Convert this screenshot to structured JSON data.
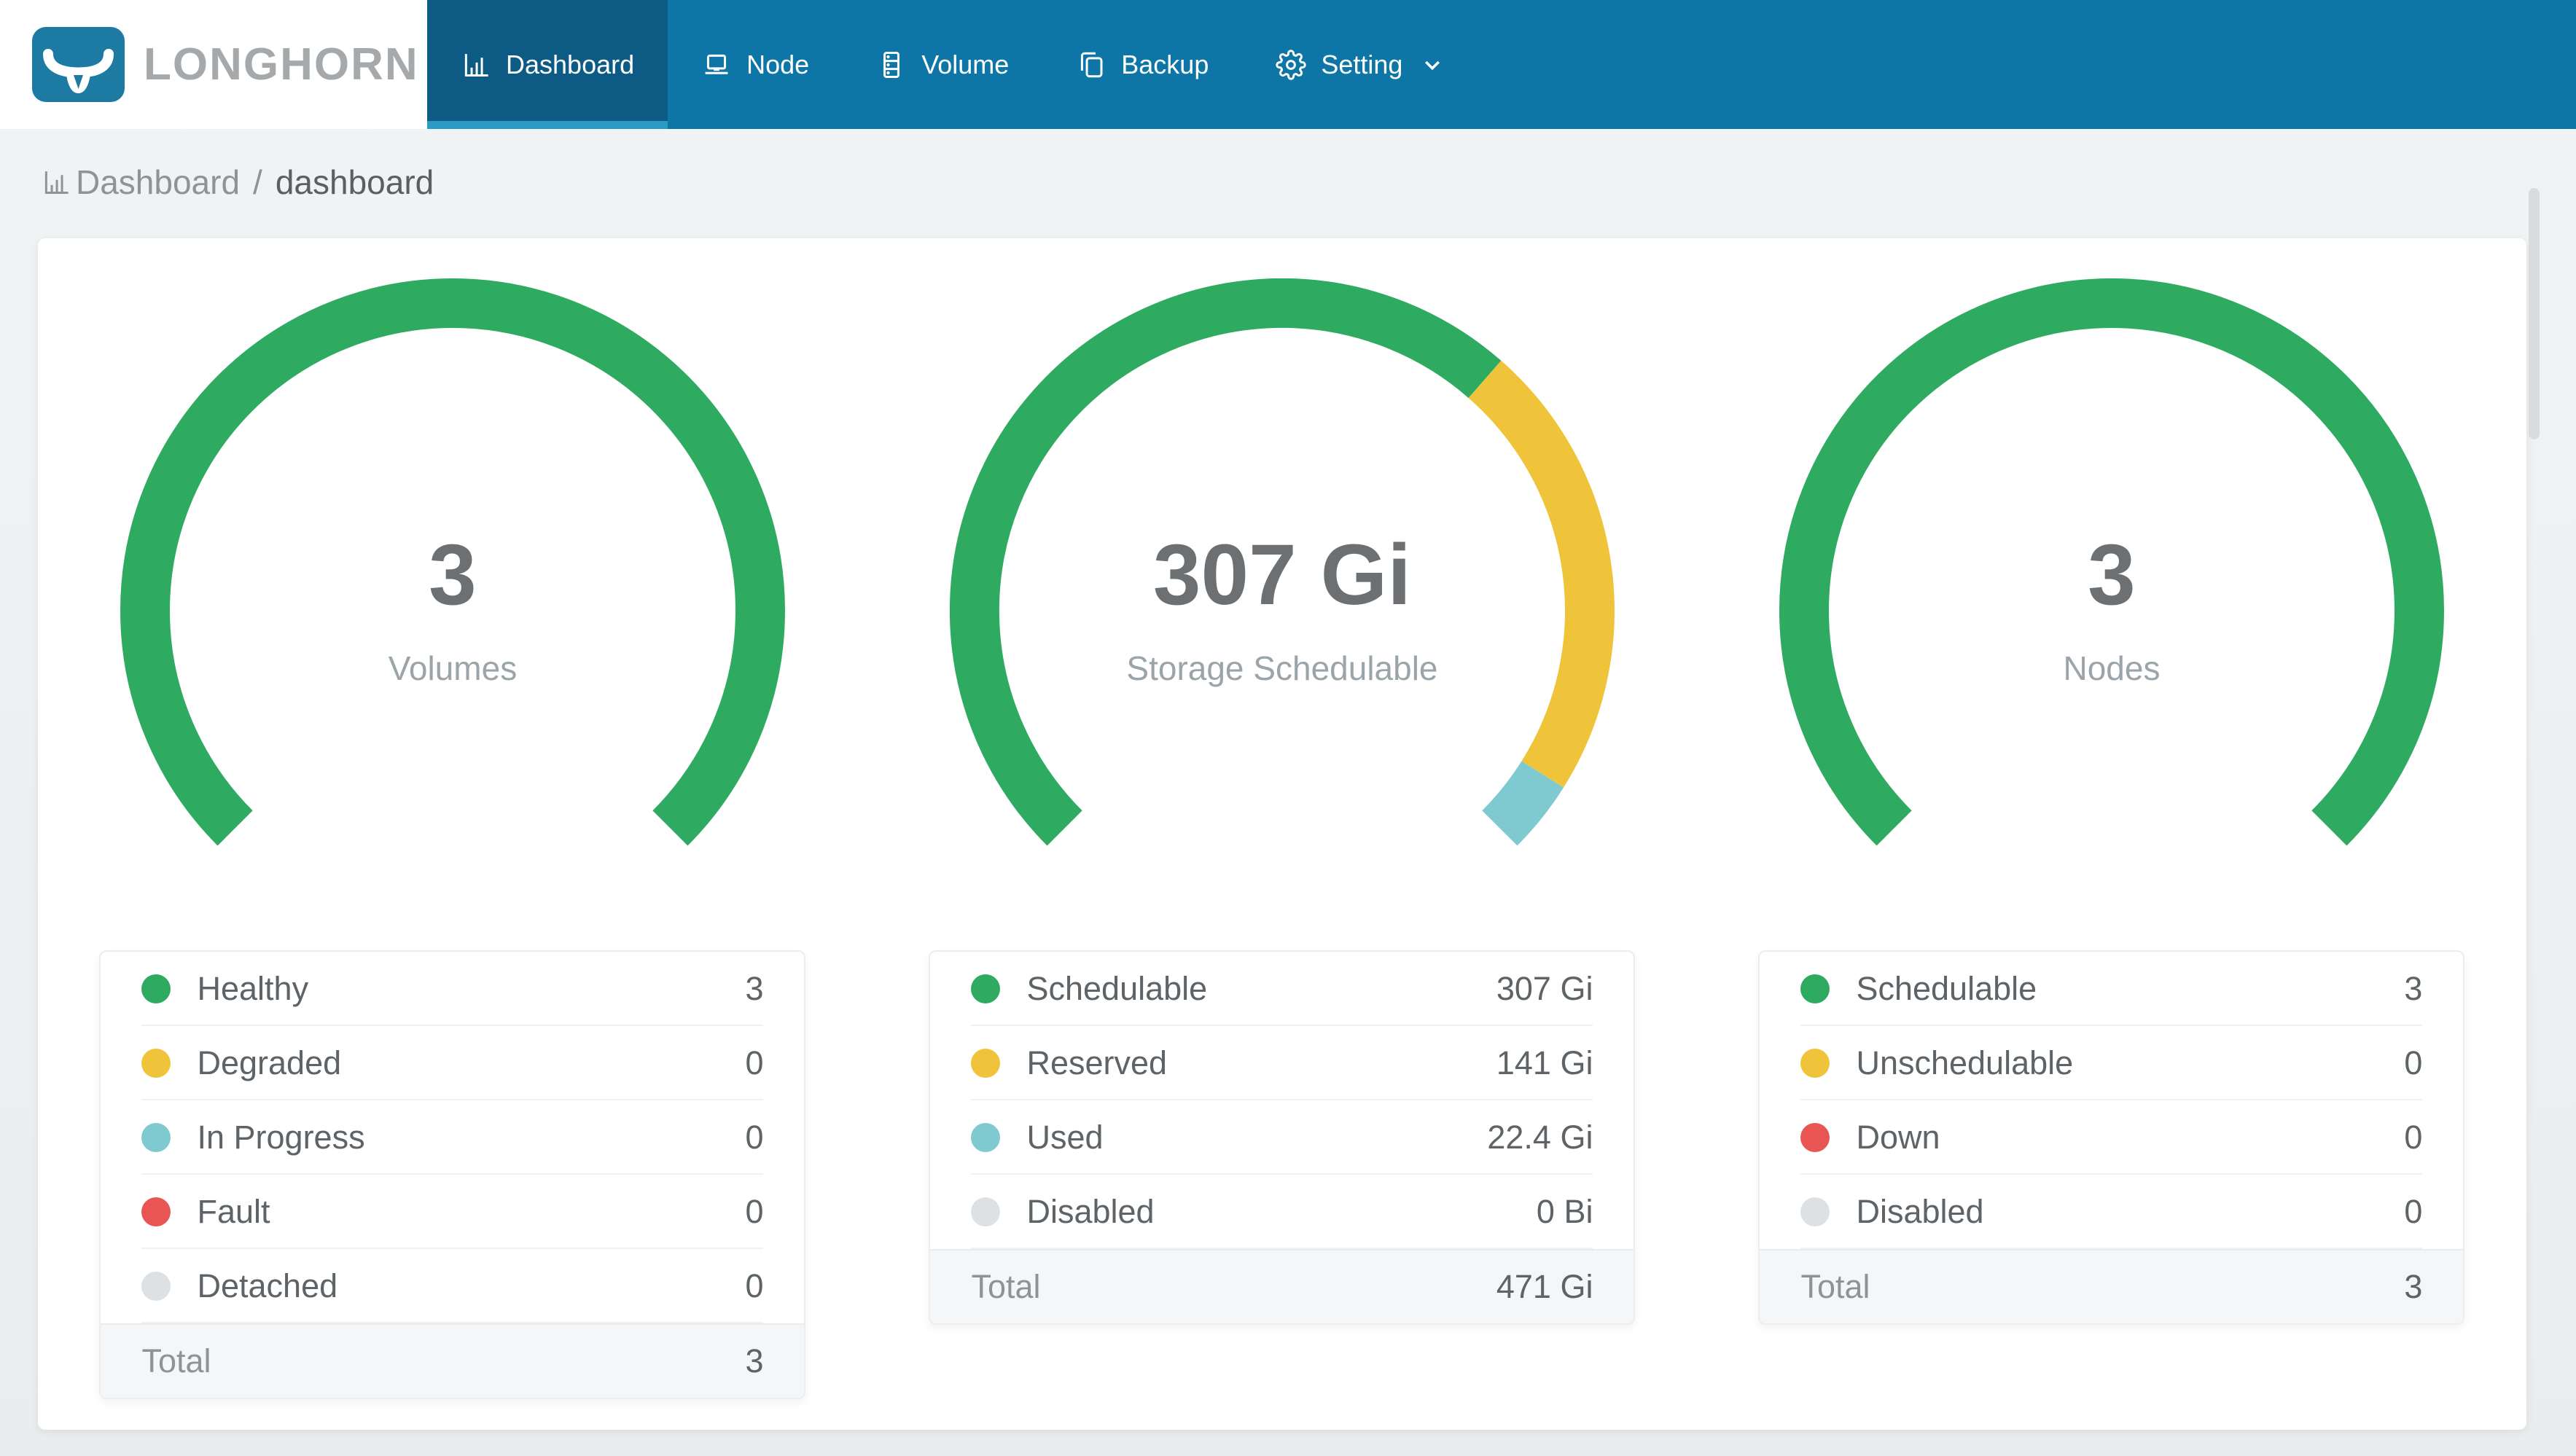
{
  "brand": {
    "name": "LONGHORN"
  },
  "nav": {
    "items": [
      {
        "label": "Dashboard",
        "icon": "dashboard-icon",
        "active": true,
        "has_dropdown": false
      },
      {
        "label": "Node",
        "icon": "node-icon",
        "active": false,
        "has_dropdown": false
      },
      {
        "label": "Volume",
        "icon": "volume-icon",
        "active": false,
        "has_dropdown": false
      },
      {
        "label": "Backup",
        "icon": "backup-icon",
        "active": false,
        "has_dropdown": false
      },
      {
        "label": "Setting",
        "icon": "setting-icon",
        "active": false,
        "has_dropdown": true
      }
    ]
  },
  "breadcrumb": {
    "root": "Dashboard",
    "separator": "/",
    "current": "dashboard"
  },
  "theme": {
    "navbar_bg": "#0e76a6",
    "navbar_active_bg": "#0d5b85",
    "navbar_active_underline": "#2a9bc4",
    "page_bg": "#edf0f1",
    "green": "#2fab61",
    "yellow": "#f0c43a",
    "teal": "#7fc9d0",
    "red": "#e95553",
    "gray": "#dde1e4"
  },
  "chart_data": [
    {
      "type": "gauge-donut",
      "arc_span_degrees": 270,
      "start_angle": 225,
      "center_value": "3",
      "center_label": "Volumes",
      "segments": [
        {
          "label": "Healthy",
          "value": 3,
          "display": "3",
          "color": "#2fab61"
        },
        {
          "label": "Degraded",
          "value": 0,
          "display": "0",
          "color": "#f0c43a"
        },
        {
          "label": "In Progress",
          "value": 0,
          "display": "0",
          "color": "#7fc9d0"
        },
        {
          "label": "Fault",
          "value": 0,
          "display": "0",
          "color": "#e95553"
        },
        {
          "label": "Detached",
          "value": 0,
          "display": "0",
          "color": "#dde1e4"
        }
      ],
      "total": {
        "label": "Total",
        "value": 3,
        "display": "3"
      }
    },
    {
      "type": "gauge-donut",
      "arc_span_degrees": 270,
      "start_angle": 225,
      "center_value": "307 Gi",
      "center_label": "Storage Schedulable",
      "segments": [
        {
          "label": "Schedulable",
          "value": 307,
          "display": "307 Gi",
          "color": "#2fab61"
        },
        {
          "label": "Reserved",
          "value": 141,
          "display": "141 Gi",
          "color": "#f0c43a"
        },
        {
          "label": "Used",
          "value": 22.4,
          "display": "22.4 Gi",
          "color": "#7fc9d0"
        },
        {
          "label": "Disabled",
          "value": 0,
          "display": "0 Bi",
          "color": "#dde1e4"
        }
      ],
      "total": {
        "label": "Total",
        "value": 470.4,
        "display": "471 Gi"
      }
    },
    {
      "type": "gauge-donut",
      "arc_span_degrees": 270,
      "start_angle": 225,
      "center_value": "3",
      "center_label": "Nodes",
      "segments": [
        {
          "label": "Schedulable",
          "value": 3,
          "display": "3",
          "color": "#2fab61"
        },
        {
          "label": "Unschedulable",
          "value": 0,
          "display": "0",
          "color": "#f0c43a"
        },
        {
          "label": "Down",
          "value": 0,
          "display": "0",
          "color": "#e95553"
        },
        {
          "label": "Disabled",
          "value": 0,
          "display": "0",
          "color": "#dde1e4"
        }
      ],
      "total": {
        "label": "Total",
        "value": 3,
        "display": "3"
      }
    }
  ]
}
